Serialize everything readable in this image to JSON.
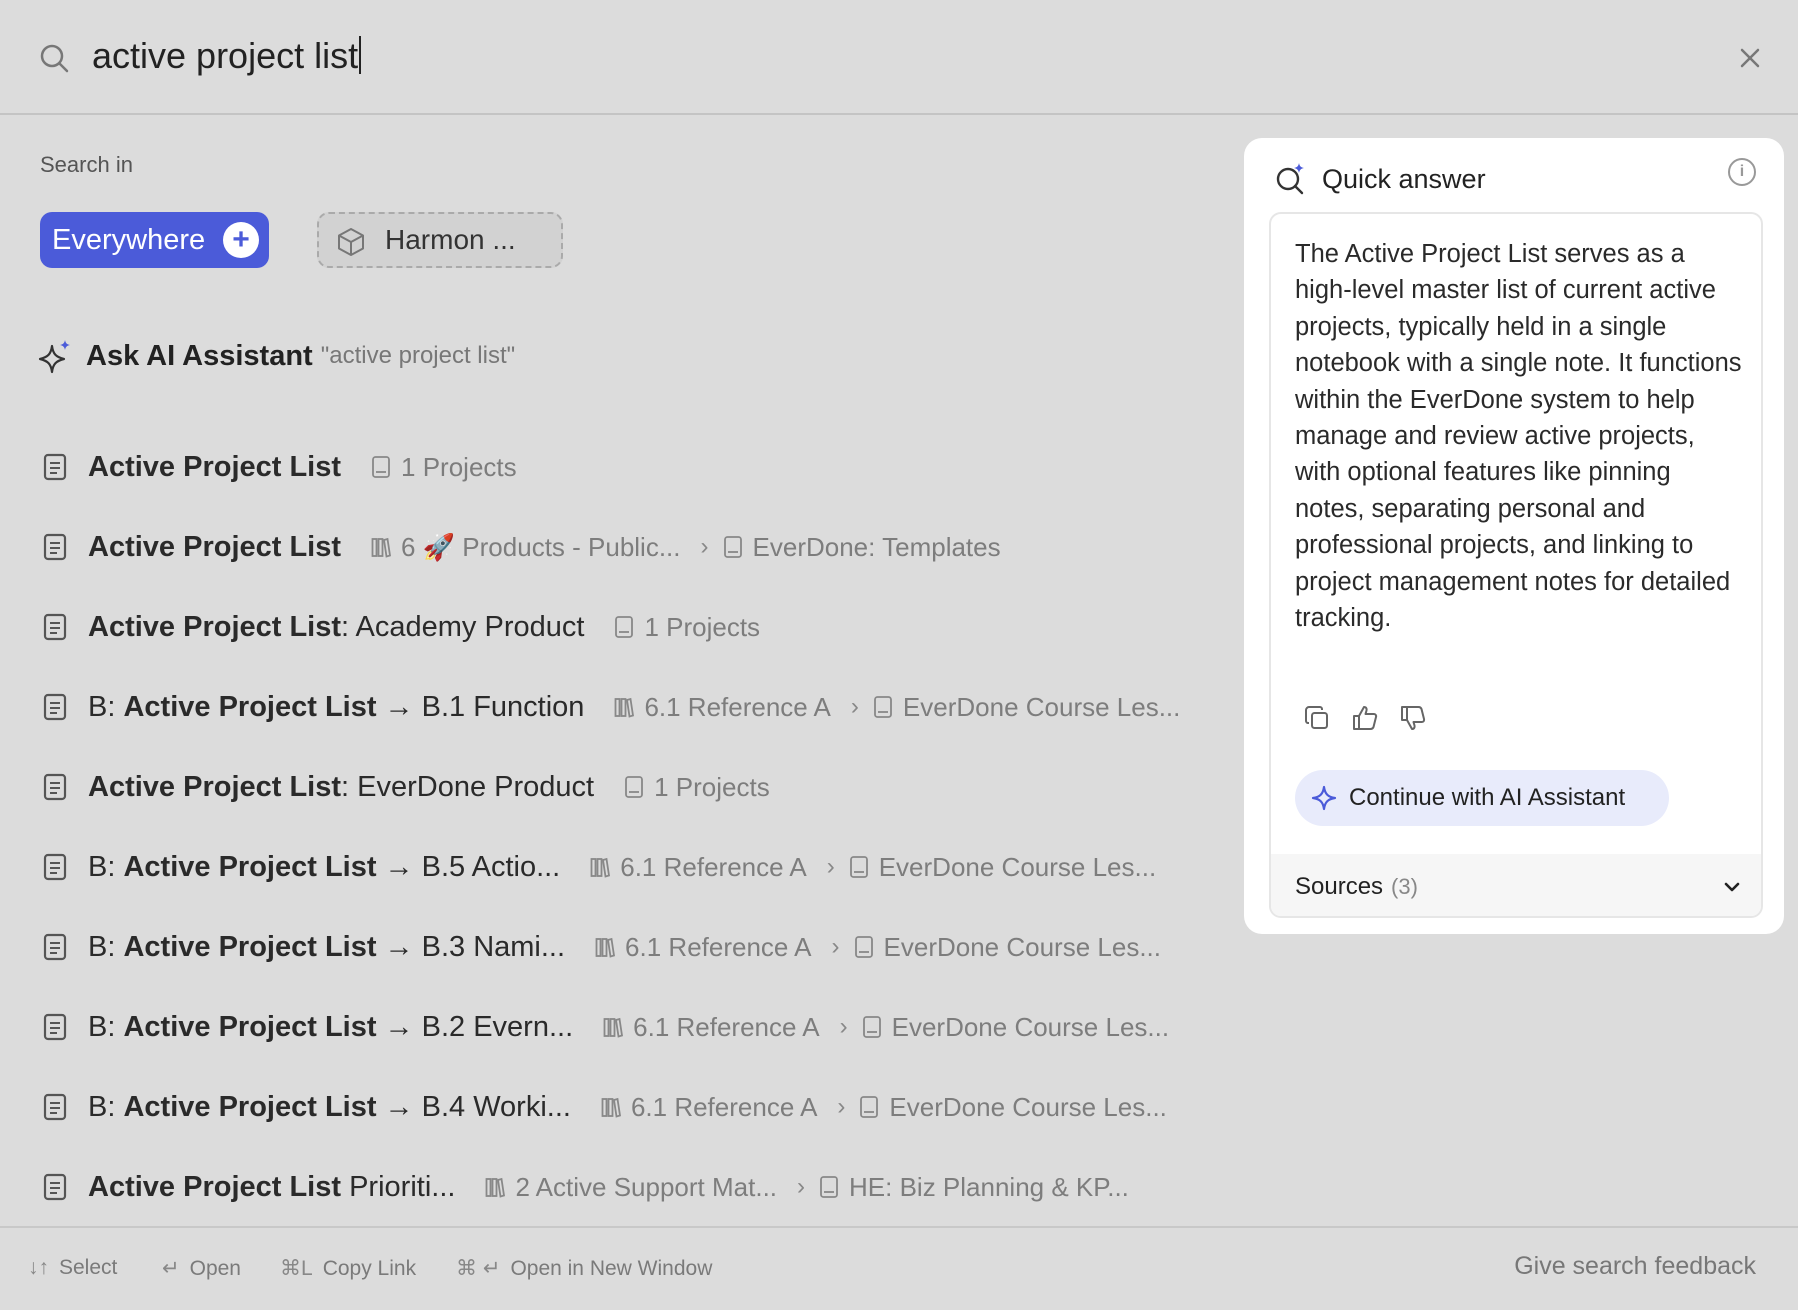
{
  "search": {
    "query": "active project list"
  },
  "scope": {
    "label": "Search in",
    "everywhere": "Everywhere",
    "space": "Harmon ..."
  },
  "ask_ai": {
    "label": "Ask AI Assistant",
    "query": "\"active project list\""
  },
  "results": [
    {
      "prefix": "",
      "bold": "Active Project List",
      "suffix": "",
      "stack": "",
      "notebook": "1 Projects"
    },
    {
      "prefix": "",
      "bold": "Active Project List",
      "suffix": "",
      "stack": "6 🚀 Products - Public...",
      "notebook": "EverDone: Templates"
    },
    {
      "prefix": "",
      "bold": "Active Project List",
      "suffix": ": Academy Product",
      "stack": "",
      "notebook": "1 Projects"
    },
    {
      "prefix": "B: ",
      "bold": "Active Project List",
      "suffix": " → B.1 Function",
      "stack": "6.1 Reference A",
      "notebook": "EverDone Course Les..."
    },
    {
      "prefix": "",
      "bold": "Active Project List",
      "suffix": ": EverDone Product",
      "stack": "",
      "notebook": "1 Projects"
    },
    {
      "prefix": "B: ",
      "bold": "Active Project List",
      "suffix": " → B.5 Actio...",
      "stack": "6.1 Reference A",
      "notebook": "EverDone Course Les..."
    },
    {
      "prefix": "B: ",
      "bold": "Active Project List",
      "suffix": " → B.3 Nami...",
      "stack": "6.1 Reference A",
      "notebook": "EverDone Course Les..."
    },
    {
      "prefix": "B: ",
      "bold": "Active Project List",
      "suffix": " → B.2 Evern...",
      "stack": "6.1 Reference A",
      "notebook": "EverDone Course Les..."
    },
    {
      "prefix": "B: ",
      "bold": "Active Project List",
      "suffix": " → B.4 Worki...",
      "stack": "6.1 Reference A",
      "notebook": "EverDone Course Les..."
    },
    {
      "prefix": "",
      "bold": "Active Project List",
      "suffix": " Prioriti...",
      "stack": "2 Active Support Mat...",
      "notebook": "HE: Biz Planning & KP..."
    }
  ],
  "quick_answer": {
    "title": "Quick answer",
    "info": "i",
    "text": "The Active Project List serves as a high-level master list of current active projects, typically held in a single notebook with a single note. It functions within the EverDone system to help manage and review active projects, with optional features like pinning notes, separating personal and professional projects, and linking to project management notes for detailed tracking.",
    "continue_label": "Continue with AI Assistant",
    "sources_label": "Sources",
    "sources_count": "(3)"
  },
  "footer": {
    "select_key": "↓↑",
    "select": "Select",
    "open_key": "↵",
    "open": "Open",
    "copy_key": "⌘L",
    "copy": "Copy Link",
    "newwin_key": "⌘ ↵",
    "newwin": "Open in New Window",
    "feedback": "Give search feedback"
  },
  "colors": {
    "accent": "#4b5bd9",
    "background": "#dcdcdc",
    "panel": "#ffffff"
  },
  "icons": [
    "search-icon",
    "close-icon",
    "plus-icon",
    "cube-icon",
    "sparkle-icon",
    "note-icon",
    "notebook-icon",
    "stack-icon",
    "chevron-right-icon",
    "copy-icon",
    "thumbs-up-icon",
    "thumbs-down-icon",
    "info-icon",
    "chevron-down-icon"
  ]
}
